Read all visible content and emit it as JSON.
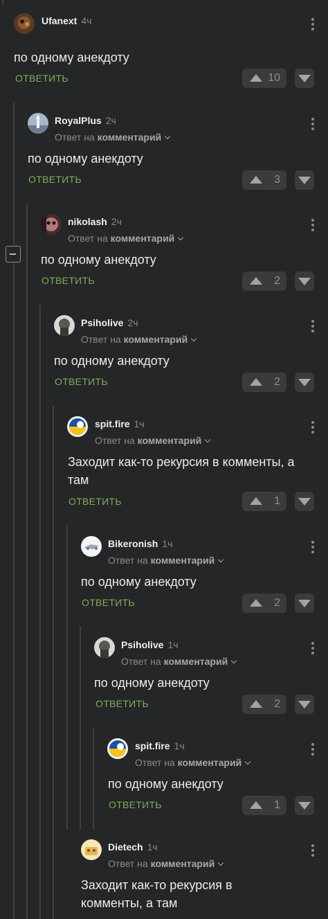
{
  "reply_label": "ОТВЕТИТЬ",
  "comments": [
    {
      "author": "Ufanext",
      "time": "4ч",
      "reply_prefix": "",
      "reply_target": "",
      "text": "по одному анекдоту",
      "votes": "10",
      "avatar": "avatar-ufanext"
    },
    {
      "author": "RoyalPlus",
      "time": "2ч",
      "reply_prefix": "Ответ на",
      "reply_target": "комментарий",
      "text": "по одному анекдоту",
      "votes": "3",
      "avatar": "avatar-royalplus"
    },
    {
      "author": "nikolash",
      "time": "2ч",
      "reply_prefix": "Ответ на",
      "reply_target": "комментарий",
      "text": "по одному анекдоту",
      "votes": "2",
      "avatar": "avatar-nikolash"
    },
    {
      "author": "Psiholive",
      "time": "2ч",
      "reply_prefix": "Ответ на",
      "reply_target": "комментарий",
      "text": "по одному анекдоту",
      "votes": "2",
      "avatar": "avatar-psiholive"
    },
    {
      "author": "spit.fire",
      "time": "1ч",
      "reply_prefix": "Ответ на",
      "reply_target": "комментарий",
      "text": "Заходит как-то рекурсия в комменты, а там",
      "votes": "1",
      "avatar": "avatar-spitfire"
    },
    {
      "author": "Bikeronish",
      "time": "1ч",
      "reply_prefix": "Ответ на",
      "reply_target": "комментарий",
      "text": "по одному анекдоту",
      "votes": "2",
      "avatar": "avatar-bikeronish"
    },
    {
      "author": "Psiholive",
      "time": "1ч",
      "reply_prefix": "Ответ на",
      "reply_target": "комментарий",
      "text": "по одному анекдоту",
      "votes": "2",
      "avatar": "avatar-psiholive"
    },
    {
      "author": "spit.fire",
      "time": "1ч",
      "reply_prefix": "Ответ на",
      "reply_target": "комментарий",
      "text": "по одному анекдоту",
      "votes": "1",
      "avatar": "avatar-spitfire"
    },
    {
      "author": "Dietech",
      "time": "1ч",
      "reply_prefix": "Ответ на",
      "reply_target": "комментарий",
      "text": "Заходит как-то рекурсия в комменты, а там",
      "votes": "",
      "avatar": "avatar-dietech"
    }
  ]
}
